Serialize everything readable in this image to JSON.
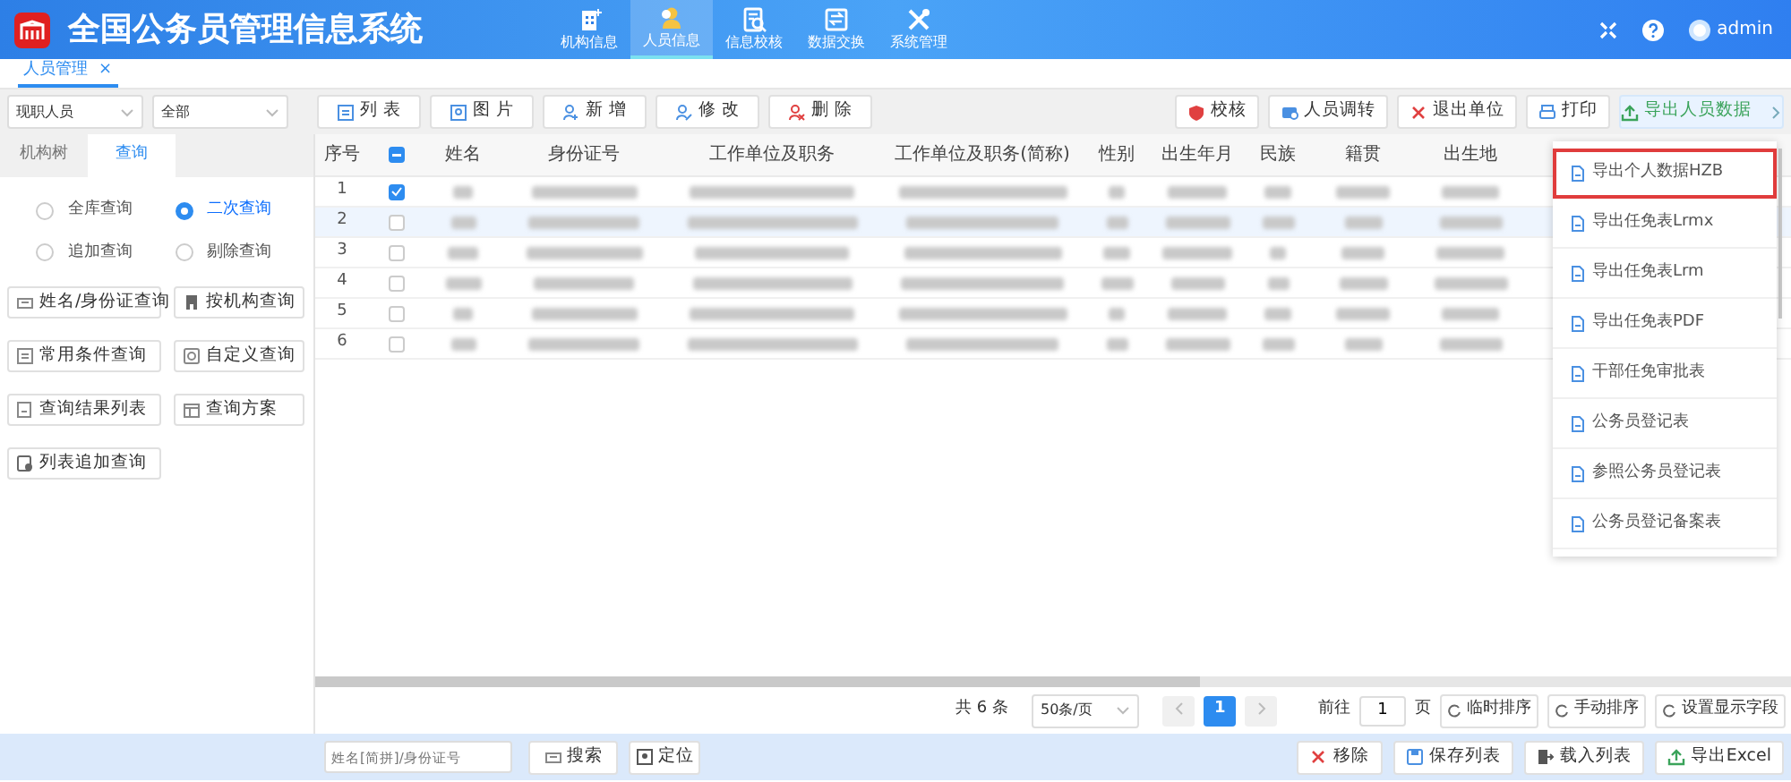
{
  "header": {
    "title": "全国公务员管理信息系统",
    "nav": [
      {
        "label": "机构信息",
        "kind": "building",
        "selected": false
      },
      {
        "label": "人员信息",
        "kind": "person",
        "selected": true
      },
      {
        "label": "信息校核",
        "kind": "check",
        "selected": false
      },
      {
        "label": "数据交换",
        "kind": "exchange",
        "selected": false
      },
      {
        "label": "系统管理",
        "kind": "tools",
        "selected": false
      }
    ],
    "user": "admin"
  },
  "page_tabs": [
    {
      "label": "人员管理",
      "close": "×",
      "selected": true
    }
  ],
  "toolbar": {
    "filters": [
      {
        "value": "现职人员"
      },
      {
        "value": "全部"
      }
    ],
    "left_buttons": [
      {
        "label": "列 表",
        "kind": "list"
      },
      {
        "label": "图 片",
        "kind": "picture"
      },
      {
        "label": "新 增",
        "kind": "add"
      },
      {
        "label": "修 改",
        "kind": "edit"
      },
      {
        "label": "删 除",
        "kind": "delete"
      }
    ],
    "right_buttons": [
      {
        "label": "校核",
        "kind": "shield"
      },
      {
        "label": "人员调转",
        "kind": "transfer"
      },
      {
        "label": "退出单位",
        "kind": "close"
      },
      {
        "label": "打印",
        "kind": "print"
      },
      {
        "label": "导出人员数据",
        "kind": "export",
        "expanded": true
      }
    ]
  },
  "sidebar": {
    "tabs": [
      {
        "label": "机构树",
        "selected": false
      },
      {
        "label": "查询",
        "selected": true
      }
    ],
    "radios": [
      {
        "label": "全库查询",
        "selected": false
      },
      {
        "label": "二次查询",
        "selected": true
      },
      {
        "label": "追加查询",
        "selected": false
      },
      {
        "label": "剔除查询",
        "selected": false
      }
    ],
    "buttons": [
      {
        "label": "姓名/身份证查询"
      },
      {
        "label": "按机构查询"
      },
      {
        "label": "常用条件查询"
      },
      {
        "label": "自定义查询"
      },
      {
        "label": "查询结果列表"
      },
      {
        "label": "查询方案"
      },
      {
        "label": "列表追加查询"
      }
    ]
  },
  "table": {
    "select_all_indeterminate": true,
    "columns": [
      "序号",
      "姓名",
      "身份证号",
      "工作单位及职务",
      "工作单位及职务(简称)",
      "性别",
      "出生年月",
      "民族",
      "籍贯",
      "出生地"
    ],
    "rows": [
      {
        "index": "1",
        "checked": true,
        "selected": false
      },
      {
        "index": "2",
        "checked": false,
        "selected": true
      },
      {
        "index": "3",
        "checked": false,
        "selected": false
      },
      {
        "index": "4",
        "checked": false,
        "selected": false
      },
      {
        "index": "5",
        "checked": false,
        "selected": false
      },
      {
        "index": "6",
        "checked": false,
        "selected": false
      }
    ]
  },
  "export_menu": [
    {
      "label": "导出个人数据HZB",
      "selected": true
    },
    {
      "label": "导出任免表Lrmx",
      "selected": false
    },
    {
      "label": "导出任免表Lrm",
      "selected": false
    },
    {
      "label": "导出任免表PDF",
      "selected": false
    },
    {
      "label": "干部任免审批表",
      "selected": false
    },
    {
      "label": "公务员登记表",
      "selected": false
    },
    {
      "label": "参照公务员登记表",
      "selected": false
    },
    {
      "label": "公务员登记备案表",
      "selected": false
    }
  ],
  "pagination": {
    "total": "共 6 条",
    "page_size": "50条/页",
    "pages": [
      {
        "label": "1",
        "selected": true
      }
    ],
    "goto_label": "前往",
    "goto_value": "1",
    "page_unit": "页",
    "buttons": [
      "临时排序",
      "手动排序",
      "设置显示字段"
    ]
  },
  "bottom_bar": {
    "search_placeholder": "姓名[简拼]/身份证号",
    "search": "搜索",
    "locate": "定位",
    "buttons": [
      {
        "label": "移除",
        "kind": "remove"
      },
      {
        "label": "保存列表",
        "kind": "save"
      },
      {
        "label": "载入列表",
        "kind": "load"
      },
      {
        "label": "导出Excel",
        "kind": "export"
      }
    ]
  }
}
